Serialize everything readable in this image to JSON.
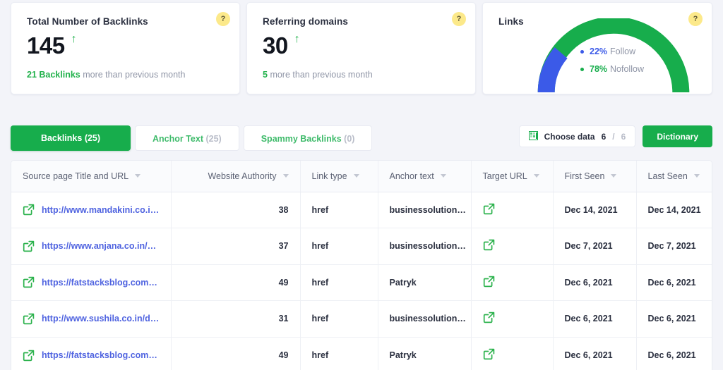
{
  "cards": [
    {
      "id": "total-backlinks",
      "title": "Total Number of Backlinks",
      "value": "145",
      "trend_icon": "↑",
      "sub_highlight": "21 Backlinks",
      "sub_text": "more than previous month",
      "help": "?"
    },
    {
      "id": "referring-domains",
      "title": "Referring domains",
      "value": "30",
      "trend_icon": "↑",
      "sub_highlight": "5",
      "sub_text": "more than previous month",
      "help": "?"
    }
  ],
  "links_card": {
    "title": "Links",
    "help": "?",
    "legend": [
      {
        "pct": "22%",
        "label": "Follow",
        "color": "#3b5ae8"
      },
      {
        "pct": "78%",
        "label": "Nofollow",
        "color": "#17ad4c"
      }
    ]
  },
  "chart_data": {
    "type": "pie",
    "title": "Links",
    "subtype": "half-donut-gauge",
    "labels": [
      "Follow",
      "Nofollow"
    ],
    "values": [
      22,
      78
    ],
    "value_labels": [
      "22%",
      "78%"
    ],
    "colors": [
      "#3b5ae8",
      "#17ad4c"
    ],
    "legend_position": "center",
    "grid": false
  },
  "tabs": [
    {
      "label": "Backlinks",
      "count": "(25)",
      "active": true
    },
    {
      "label": "Anchor Text",
      "count": "(25)",
      "active": false
    },
    {
      "label": "Spammy Backlinks",
      "count": "(0)",
      "active": false
    }
  ],
  "toolbar": {
    "choose_data_label": "Choose data",
    "choose_data_selected": "6",
    "choose_data_separator": "/",
    "choose_data_total": "6",
    "dictionary_label": "Dictionary"
  },
  "table": {
    "columns": [
      "Source page Title and URL",
      "Website Authority",
      "Link type",
      "Anchor text",
      "Target URL",
      "First Seen",
      "Last Seen"
    ],
    "rows": [
      {
        "source": "http://www.mandakini.co.in…",
        "authority": "38",
        "link_type": "href",
        "anchor": "businessolution…",
        "target": "open-external-icon",
        "first_seen": "Dec 14, 2021",
        "last_seen": "Dec 14, 2021"
      },
      {
        "source": "https://www.anjana.co.in/d…",
        "authority": "37",
        "link_type": "href",
        "anchor": "businessolution…",
        "target": "open-external-icon",
        "first_seen": "Dec 7, 2021",
        "last_seen": "Dec 7, 2021"
      },
      {
        "source": "https://fatstacksblog.com/…",
        "authority": "49",
        "link_type": "href",
        "anchor": "Patryk",
        "target": "open-external-icon",
        "first_seen": "Dec 6, 2021",
        "last_seen": "Dec 6, 2021"
      },
      {
        "source": "http://www.sushila.co.in/do…",
        "authority": "31",
        "link_type": "href",
        "anchor": "businessolution…",
        "target": "open-external-icon",
        "first_seen": "Dec 6, 2021",
        "last_seen": "Dec 6, 2021"
      },
      {
        "source": "https://fatstacksblog.com/…",
        "authority": "49",
        "link_type": "href",
        "anchor": "Patryk",
        "target": "open-external-icon",
        "first_seen": "Dec 6, 2021",
        "last_seen": "Dec 6, 2021"
      }
    ]
  },
  "colors": {
    "brand_green": "#17ad4c",
    "link_blue": "#4f63e0",
    "follow_blue": "#3b5ae8",
    "help_yellow": "#fce98a",
    "page_bg": "#f3f4f9"
  }
}
